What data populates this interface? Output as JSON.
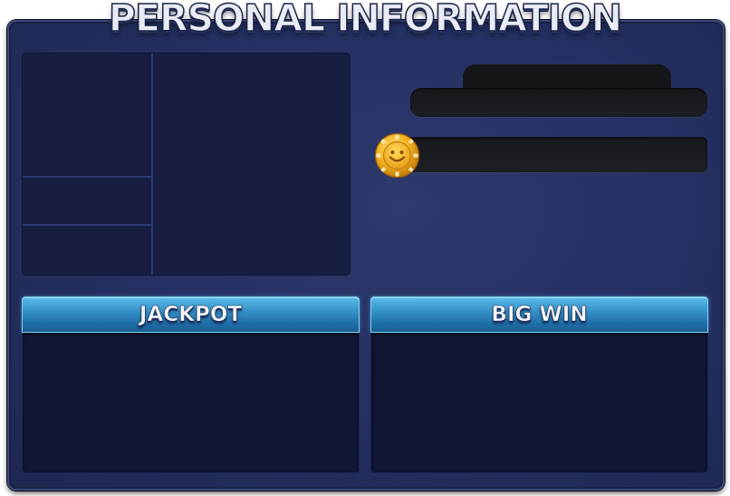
{
  "title": "PERSONAL INFORMATION",
  "tabs": [
    {
      "label": "JACKPOT"
    },
    {
      "label": "BIG WIN"
    }
  ],
  "icons": {
    "coin": "coin-icon"
  },
  "colors": {
    "frame": "#253164",
    "tab_header": "#3592c8",
    "panel_dark": "#101634",
    "coin_gold": "#f2b01e"
  }
}
